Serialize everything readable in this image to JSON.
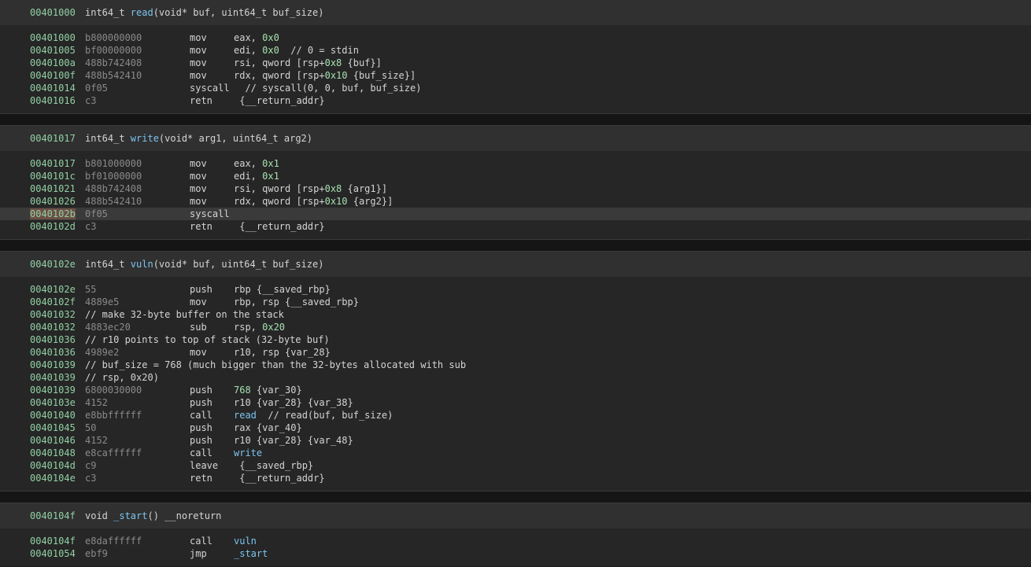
{
  "functions": [
    {
      "addr": "00401000",
      "rtype": "int64_t ",
      "name": "read",
      "params": "(void* buf, uint64_t buf_size)",
      "lines": [
        {
          "addr": "00401000",
          "bytes": "b800000000",
          "mnem": "mov",
          "ops": [
            {
              "t": "eax, "
            },
            {
              "t": "0x0",
              "k": "num"
            }
          ]
        },
        {
          "addr": "00401005",
          "bytes": "bf00000000",
          "mnem": "mov",
          "ops": [
            {
              "t": "edi, "
            },
            {
              "t": "0x0",
              "k": "num"
            },
            {
              "t": "  // 0 = stdin",
              "k": "cmt"
            }
          ]
        },
        {
          "addr": "0040100a",
          "bytes": "488b742408",
          "mnem": "mov",
          "ops": [
            {
              "t": "rsi, qword [rsp+"
            },
            {
              "t": "0x8",
              "k": "num"
            },
            {
              "t": " {buf}]"
            }
          ]
        },
        {
          "addr": "0040100f",
          "bytes": "488b542410",
          "mnem": "mov",
          "ops": [
            {
              "t": "rdx, qword [rsp+"
            },
            {
              "t": "0x10",
              "k": "num"
            },
            {
              "t": " {buf_size}]"
            }
          ]
        },
        {
          "addr": "00401014",
          "bytes": "0f05",
          "mnem": "syscall",
          "ops": [
            {
              "t": "  // syscall(0, 0, buf, buf_size)",
              "k": "cmt"
            }
          ]
        },
        {
          "addr": "00401016",
          "bytes": "c3",
          "mnem": "retn",
          "ops": [
            {
              "t": " {__return_addr}"
            }
          ]
        }
      ]
    },
    {
      "addr": "00401017",
      "rtype": "int64_t ",
      "name": "write",
      "params": "(void* arg1, uint64_t arg2)",
      "lines": [
        {
          "addr": "00401017",
          "bytes": "b801000000",
          "mnem": "mov",
          "ops": [
            {
              "t": "eax, "
            },
            {
              "t": "0x1",
              "k": "num"
            }
          ]
        },
        {
          "addr": "0040101c",
          "bytes": "bf01000000",
          "mnem": "mov",
          "ops": [
            {
              "t": "edi, "
            },
            {
              "t": "0x1",
              "k": "num"
            }
          ]
        },
        {
          "addr": "00401021",
          "bytes": "488b742408",
          "mnem": "mov",
          "ops": [
            {
              "t": "rsi, qword [rsp+"
            },
            {
              "t": "0x8",
              "k": "num"
            },
            {
              "t": " {arg1}]"
            }
          ]
        },
        {
          "addr": "00401026",
          "bytes": "488b542410",
          "mnem": "mov",
          "ops": [
            {
              "t": "rdx, qword [rsp+"
            },
            {
              "t": "0x10",
              "k": "num"
            },
            {
              "t": " {arg2}]"
            }
          ]
        },
        {
          "addr": "0040102b",
          "bytes": "0f05",
          "mnem": "syscall",
          "ops": [],
          "highlight": true
        },
        {
          "addr": "0040102d",
          "bytes": "c3",
          "mnem": "retn",
          "ops": [
            {
              "t": " {__return_addr}"
            }
          ]
        }
      ]
    },
    {
      "addr": "0040102e",
      "rtype": "int64_t ",
      "name": "vuln",
      "params": "(void* buf, uint64_t buf_size)",
      "lines": [
        {
          "addr": "0040102e",
          "bytes": "55",
          "mnem": "push",
          "ops": [
            {
              "t": "rbp {__saved_rbp}"
            }
          ]
        },
        {
          "addr": "0040102f",
          "bytes": "4889e5",
          "mnem": "mov",
          "ops": [
            {
              "t": "rbp, rsp {__saved_rbp}"
            }
          ]
        },
        {
          "addr": "00401032",
          "comment": "// make 32-byte buffer on the stack"
        },
        {
          "addr": "00401032",
          "bytes": "4883ec20",
          "mnem": "sub",
          "ops": [
            {
              "t": "rsp, "
            },
            {
              "t": "0x20",
              "k": "num"
            }
          ]
        },
        {
          "addr": "00401036",
          "comment": "// r10 points to top of stack (32-byte buf)"
        },
        {
          "addr": "00401036",
          "bytes": "4989e2",
          "mnem": "mov",
          "ops": [
            {
              "t": "r10, rsp {var_28}"
            }
          ]
        },
        {
          "addr": "00401039",
          "comment": "// buf_size = 768 (much bigger than the 32-bytes allocated with sub"
        },
        {
          "addr": "00401039",
          "comment": "// rsp, 0x20)"
        },
        {
          "addr": "00401039",
          "bytes": "6800030000",
          "mnem": "push",
          "ops": [
            {
              "t": "768",
              "k": "num"
            },
            {
              "t": " {var_30}"
            }
          ]
        },
        {
          "addr": "0040103e",
          "bytes": "4152",
          "mnem": "push",
          "ops": [
            {
              "t": "r10 {var_28} {var_38}"
            }
          ]
        },
        {
          "addr": "00401040",
          "bytes": "e8bbffffff",
          "mnem": "call",
          "ops": [
            {
              "t": "read",
              "k": "fn"
            },
            {
              "t": "  // read(buf, buf_size)",
              "k": "cmt"
            }
          ]
        },
        {
          "addr": "00401045",
          "bytes": "50",
          "mnem": "push",
          "ops": [
            {
              "t": "rax {var_40}"
            }
          ]
        },
        {
          "addr": "00401046",
          "bytes": "4152",
          "mnem": "push",
          "ops": [
            {
              "t": "r10 {var_28} {var_48}"
            }
          ]
        },
        {
          "addr": "00401048",
          "bytes": "e8caffffff",
          "mnem": "call",
          "ops": [
            {
              "t": "write",
              "k": "fn"
            }
          ]
        },
        {
          "addr": "0040104d",
          "bytes": "c9",
          "mnem": "leave",
          "ops": [
            {
              "t": " {__saved_rbp}"
            }
          ]
        },
        {
          "addr": "0040104e",
          "bytes": "c3",
          "mnem": "retn",
          "ops": [
            {
              "t": " {__return_addr}"
            }
          ]
        }
      ]
    },
    {
      "addr": "0040104f",
      "rtype": "void ",
      "name": "_start",
      "params": "() __noreturn",
      "lines": [
        {
          "addr": "0040104f",
          "bytes": "e8daffffff",
          "mnem": "call",
          "ops": [
            {
              "t": "vuln",
              "k": "fn"
            }
          ]
        },
        {
          "addr": "00401054",
          "bytes": "ebf9",
          "mnem": "jmp",
          "ops": [
            {
              "t": "_start",
              "k": "fn"
            }
          ]
        }
      ]
    }
  ]
}
